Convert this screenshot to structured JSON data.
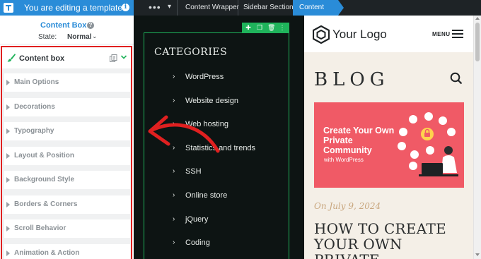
{
  "topbar": {
    "editing_notice": "You are editing a template",
    "more_label": "•••",
    "breadcrumbs": [
      "Content Wrapper",
      "Sidebar Section",
      "Content Box"
    ]
  },
  "panel": {
    "title": "Content Box",
    "state_label": "State:",
    "state_value": "Normal",
    "block_label": "Content box",
    "sections": [
      "Main Options",
      "Decorations",
      "Typography",
      "Layout & Position",
      "Background Style",
      "Borders & Corners",
      "Scroll Behavior",
      "Animation & Action"
    ]
  },
  "categories": {
    "title": "CATEGORIES",
    "items": [
      "WordPress",
      "Website design",
      "Web hosting",
      "Statistics and trends",
      "SSH",
      "Online store",
      "jQuery",
      "Coding"
    ]
  },
  "preview": {
    "logo_text": "Your Logo",
    "menu_label": "MENU",
    "blog_heading": "BLOG",
    "hero_title": "Create Your Own Private Community",
    "hero_subtitle": "with WordPress",
    "post_date": "On July 9, 2024",
    "post_title": "HOW TO CREATE YOUR OWN PRIVATE"
  },
  "colors": {
    "accent_blue": "#2a8cd8",
    "highlight_red": "#e02020",
    "element_green": "#1fb35b",
    "hero_pink": "#f05a66"
  },
  "icons": {
    "top_logo": "thrive-logo-icon",
    "info": "info-icon",
    "help": "help-icon",
    "block": "brush-icon",
    "config": "settings-icon",
    "collapse": "chevron-down-icon",
    "search": "search-icon",
    "menu": "hamburger-icon",
    "sidebar_toggle": "collapse-arrow-icon"
  }
}
